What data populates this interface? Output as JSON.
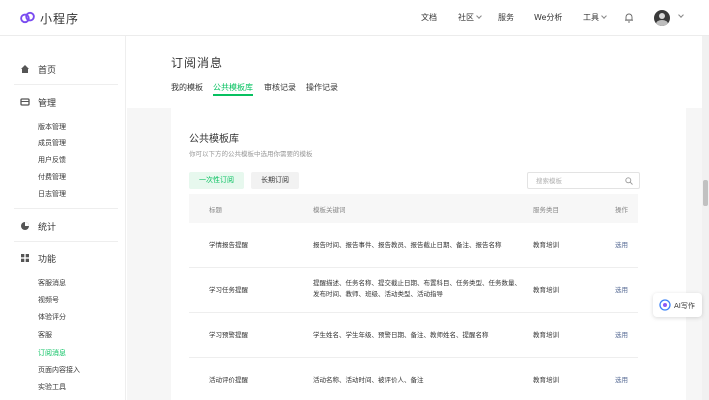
{
  "app": {
    "name": "小程序",
    "accent": "#07c160"
  },
  "nav": [
    {
      "label": "文档",
      "dropdown": false
    },
    {
      "label": "社区",
      "dropdown": true
    },
    {
      "label": "服务",
      "dropdown": false
    },
    {
      "label": "We分析",
      "dropdown": false
    },
    {
      "label": "工具",
      "dropdown": true
    }
  ],
  "sidebar": {
    "sections": [
      {
        "label": "首页",
        "icon": "home-icon"
      },
      {
        "label": "管理",
        "icon": "manage-icon"
      },
      {
        "label": "统计",
        "icon": "stats-icon"
      },
      {
        "label": "功能",
        "icon": "function-icon"
      }
    ],
    "manage_items": [
      "版本管理",
      "成员管理",
      "用户反馈",
      "付费管理",
      "日志管理"
    ],
    "function_items": [
      "客服消息",
      "视频号",
      "体验评分",
      "客服",
      "订阅消息",
      "页面内容接入",
      "实验工具"
    ]
  },
  "page": {
    "title": "订阅消息",
    "tabs": [
      "我的模板",
      "公共模板库",
      "审核记录",
      "操作记录"
    ],
    "active_tab": 1
  },
  "card": {
    "title": "公共模板库",
    "desc": "你可以下方的公共模板中选用你需要的模板",
    "btn_once": "一次性订阅",
    "btn_long": "长期订阅",
    "search_placeholder": "搜索模板"
  },
  "table": {
    "headers": [
      "标题",
      "模板关键词",
      "服务类目",
      "操作"
    ],
    "rows": [
      {
        "title": "学情报告提醒",
        "keywords": "报告时间、报告事件、报告教员、报告截止日期、备注、报告名称",
        "category": "教育培训",
        "action": "选用"
      },
      {
        "title": "学习任务提醒",
        "keywords": "提醒描述、任务名称、提交截止日期、布置科目、任务类型、任务数量、发布时间、教师、班级、活动类型、活动指导",
        "category": "教育培训",
        "action": "选用"
      },
      {
        "title": "学习预警提醒",
        "keywords": "学生姓名、学生年级、预警日期、备注、教师姓名、提醒名称",
        "category": "教育培训",
        "action": "选用"
      },
      {
        "title": "活动评价提醒",
        "keywords": "活动名称、活动时间、被评价人、备注",
        "category": "教育培训",
        "action": "选用"
      }
    ]
  },
  "ai_helper": {
    "label": "AI写作"
  }
}
